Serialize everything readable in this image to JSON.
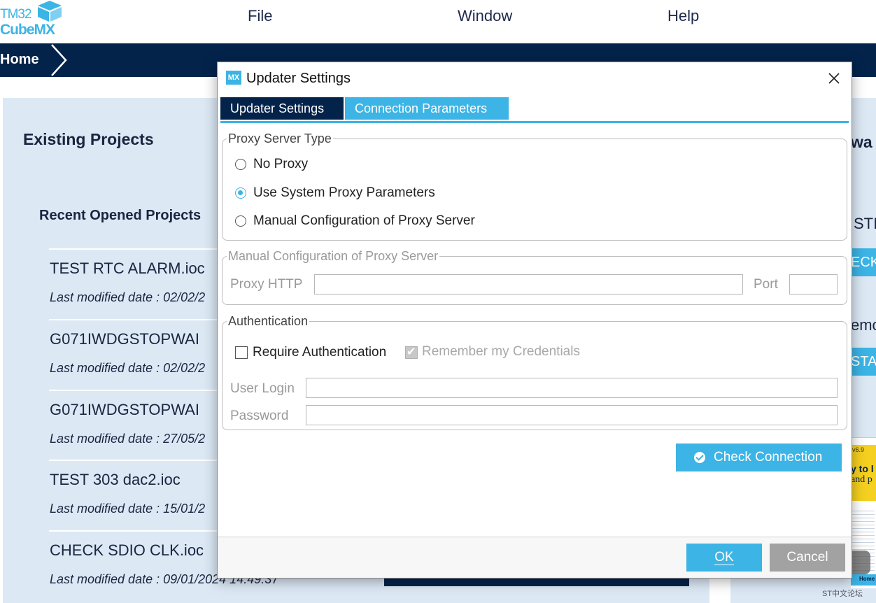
{
  "app": {
    "logo_line1": "TM32",
    "logo_line2": "CubeMX",
    "menu": [
      "File",
      "Window",
      "Help"
    ],
    "breadcrumb": "Home"
  },
  "home": {
    "existing_title": "Existing Projects",
    "recent_title": "Recent Opened Projects",
    "projects": [
      {
        "name": "TEST RTC ALARM.ioc",
        "date": "Last modified date : 02/02/2"
      },
      {
        "name": "G071IWDGSTOPWAI",
        "date": "Last modified date : 02/02/2"
      },
      {
        "name": "G071IWDGSTOPWAI",
        "date": "Last modified date : 27/05/2"
      },
      {
        "name": "TEST 303 dac2.ioc",
        "date": "Last modified date : 15/01/2"
      },
      {
        "name": "CHECK SDIO CLK.ioc",
        "date": "Last modified date : 09/01/2024 14:49:37"
      }
    ],
    "right_fragments": {
      "heading": "wa",
      "line1": "STI",
      "btn1": "ECK",
      "line2": "emo",
      "btn2": "STAL",
      "thumb_version": "v6.9",
      "thumb_line1": "y to l",
      "thumb_line2": "and p",
      "thumb_bar": "Home > Project Ma"
    },
    "watermark_text": "ST中文论坛"
  },
  "dialog": {
    "title": "Updater Settings",
    "icon_text": "MX",
    "tabs": [
      "Updater Settings",
      "Connection Parameters"
    ],
    "active_tab": 1,
    "proxy_type": {
      "legend": "Proxy Server Type",
      "options": [
        "No Proxy",
        "Use System Proxy Parameters",
        "Manual Configuration of Proxy Server"
      ],
      "selected": 1
    },
    "manual_proxy": {
      "legend": "Manual Configuration of Proxy Server",
      "http_label": "Proxy HTTP",
      "http_value": "",
      "port_label": "Port",
      "port_value": ""
    },
    "auth": {
      "legend": "Authentication",
      "require_label": "Require Authentication",
      "require_checked": false,
      "remember_label": "Remember my Credentials",
      "remember_checked": true,
      "login_label": "User Login",
      "login_value": "",
      "password_label": "Password",
      "password_value": ""
    },
    "check_button": "Check Connection",
    "ok_button": "OK",
    "cancel_button": "Cancel"
  },
  "colors": {
    "accent": "#3cb4e5",
    "navy": "#03234b",
    "panel": "#dce9f5"
  }
}
